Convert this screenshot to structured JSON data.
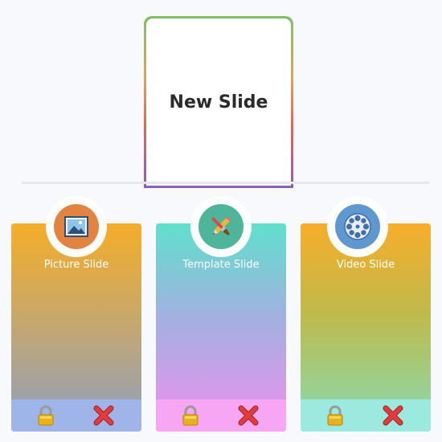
{
  "new_slide": {
    "title": "New Slide"
  },
  "cards": [
    {
      "label": "Picture Slide",
      "icon": "picture-icon",
      "badge_color": "#e2833f"
    },
    {
      "label": "Template Slide",
      "icon": "brush-pencil-icon",
      "badge_color": "#4fb59a"
    },
    {
      "label": "Video Slide",
      "icon": "film-reel-icon",
      "badge_color": "#5f98cf"
    }
  ],
  "footer_icons": {
    "lock": "lock-icon",
    "delete": "close-icon"
  },
  "colors": {
    "lock_gold": "#e8b31a",
    "delete_red": "#e23b3b"
  }
}
